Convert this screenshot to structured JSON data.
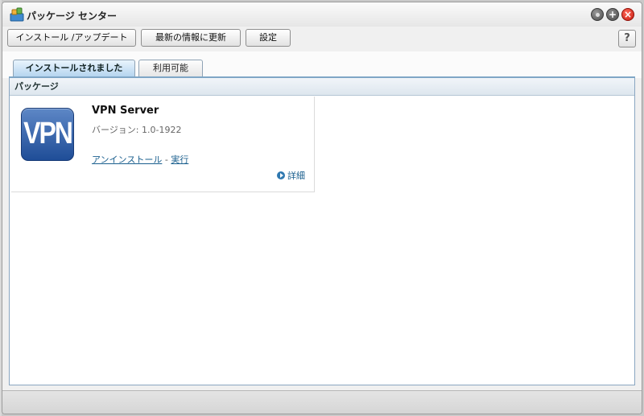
{
  "window": {
    "title": "パッケージ センター"
  },
  "toolbar": {
    "install_update_label": "インストール /アップデート",
    "refresh_label": "最新の情報に更新",
    "settings_label": "設定",
    "help_label": "?"
  },
  "tabs": [
    {
      "label": "インストールされました",
      "active": true
    },
    {
      "label": "利用可能",
      "active": false
    }
  ],
  "section": {
    "header": "パッケージ"
  },
  "package": {
    "name": "VPN Server",
    "version": "バージョン: 1.0-1922",
    "icon_text": "VPN",
    "uninstall_label": "アンインストール",
    "separator": "-",
    "run_label": "実行",
    "details_label": "詳細"
  },
  "colors": {
    "accent": "#1a5f8e",
    "tab_active": "#b5d5ef",
    "icon_blue": "#2f5fa8"
  }
}
